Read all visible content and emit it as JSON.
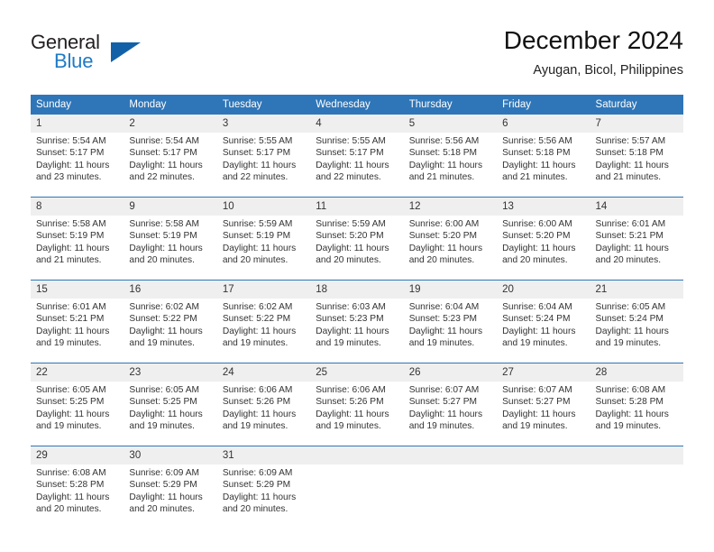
{
  "brand": {
    "name_part1": "General",
    "name_part2": "Blue",
    "triangle_icon": "triangle-icon",
    "color_dark": "#231f20",
    "color_blue": "#1f7ac6",
    "color_triangle": "#1261a8"
  },
  "header": {
    "title": "December 2024",
    "subtitle": "Ayugan, Bicol, Philippines"
  },
  "theme": {
    "header_blue": "#2f76b8",
    "daynum_gray": "#efefef",
    "text": "#333333"
  },
  "calendar": {
    "weekday_headers": [
      "Sunday",
      "Monday",
      "Tuesday",
      "Wednesday",
      "Thursday",
      "Friday",
      "Saturday"
    ],
    "weeks": [
      [
        {
          "day": "1",
          "sunrise": "Sunrise: 5:54 AM",
          "sunset": "Sunset: 5:17 PM",
          "daylight_line1": "Daylight: 11 hours",
          "daylight_line2": "and 23 minutes."
        },
        {
          "day": "2",
          "sunrise": "Sunrise: 5:54 AM",
          "sunset": "Sunset: 5:17 PM",
          "daylight_line1": "Daylight: 11 hours",
          "daylight_line2": "and 22 minutes."
        },
        {
          "day": "3",
          "sunrise": "Sunrise: 5:55 AM",
          "sunset": "Sunset: 5:17 PM",
          "daylight_line1": "Daylight: 11 hours",
          "daylight_line2": "and 22 minutes."
        },
        {
          "day": "4",
          "sunrise": "Sunrise: 5:55 AM",
          "sunset": "Sunset: 5:17 PM",
          "daylight_line1": "Daylight: 11 hours",
          "daylight_line2": "and 22 minutes."
        },
        {
          "day": "5",
          "sunrise": "Sunrise: 5:56 AM",
          "sunset": "Sunset: 5:18 PM",
          "daylight_line1": "Daylight: 11 hours",
          "daylight_line2": "and 21 minutes."
        },
        {
          "day": "6",
          "sunrise": "Sunrise: 5:56 AM",
          "sunset": "Sunset: 5:18 PM",
          "daylight_line1": "Daylight: 11 hours",
          "daylight_line2": "and 21 minutes."
        },
        {
          "day": "7",
          "sunrise": "Sunrise: 5:57 AM",
          "sunset": "Sunset: 5:18 PM",
          "daylight_line1": "Daylight: 11 hours",
          "daylight_line2": "and 21 minutes."
        }
      ],
      [
        {
          "day": "8",
          "sunrise": "Sunrise: 5:58 AM",
          "sunset": "Sunset: 5:19 PM",
          "daylight_line1": "Daylight: 11 hours",
          "daylight_line2": "and 21 minutes."
        },
        {
          "day": "9",
          "sunrise": "Sunrise: 5:58 AM",
          "sunset": "Sunset: 5:19 PM",
          "daylight_line1": "Daylight: 11 hours",
          "daylight_line2": "and 20 minutes."
        },
        {
          "day": "10",
          "sunrise": "Sunrise: 5:59 AM",
          "sunset": "Sunset: 5:19 PM",
          "daylight_line1": "Daylight: 11 hours",
          "daylight_line2": "and 20 minutes."
        },
        {
          "day": "11",
          "sunrise": "Sunrise: 5:59 AM",
          "sunset": "Sunset: 5:20 PM",
          "daylight_line1": "Daylight: 11 hours",
          "daylight_line2": "and 20 minutes."
        },
        {
          "day": "12",
          "sunrise": "Sunrise: 6:00 AM",
          "sunset": "Sunset: 5:20 PM",
          "daylight_line1": "Daylight: 11 hours",
          "daylight_line2": "and 20 minutes."
        },
        {
          "day": "13",
          "sunrise": "Sunrise: 6:00 AM",
          "sunset": "Sunset: 5:20 PM",
          "daylight_line1": "Daylight: 11 hours",
          "daylight_line2": "and 20 minutes."
        },
        {
          "day": "14",
          "sunrise": "Sunrise: 6:01 AM",
          "sunset": "Sunset: 5:21 PM",
          "daylight_line1": "Daylight: 11 hours",
          "daylight_line2": "and 20 minutes."
        }
      ],
      [
        {
          "day": "15",
          "sunrise": "Sunrise: 6:01 AM",
          "sunset": "Sunset: 5:21 PM",
          "daylight_line1": "Daylight: 11 hours",
          "daylight_line2": "and 19 minutes."
        },
        {
          "day": "16",
          "sunrise": "Sunrise: 6:02 AM",
          "sunset": "Sunset: 5:22 PM",
          "daylight_line1": "Daylight: 11 hours",
          "daylight_line2": "and 19 minutes."
        },
        {
          "day": "17",
          "sunrise": "Sunrise: 6:02 AM",
          "sunset": "Sunset: 5:22 PM",
          "daylight_line1": "Daylight: 11 hours",
          "daylight_line2": "and 19 minutes."
        },
        {
          "day": "18",
          "sunrise": "Sunrise: 6:03 AM",
          "sunset": "Sunset: 5:23 PM",
          "daylight_line1": "Daylight: 11 hours",
          "daylight_line2": "and 19 minutes."
        },
        {
          "day": "19",
          "sunrise": "Sunrise: 6:04 AM",
          "sunset": "Sunset: 5:23 PM",
          "daylight_line1": "Daylight: 11 hours",
          "daylight_line2": "and 19 minutes."
        },
        {
          "day": "20",
          "sunrise": "Sunrise: 6:04 AM",
          "sunset": "Sunset: 5:24 PM",
          "daylight_line1": "Daylight: 11 hours",
          "daylight_line2": "and 19 minutes."
        },
        {
          "day": "21",
          "sunrise": "Sunrise: 6:05 AM",
          "sunset": "Sunset: 5:24 PM",
          "daylight_line1": "Daylight: 11 hours",
          "daylight_line2": "and 19 minutes."
        }
      ],
      [
        {
          "day": "22",
          "sunrise": "Sunrise: 6:05 AM",
          "sunset": "Sunset: 5:25 PM",
          "daylight_line1": "Daylight: 11 hours",
          "daylight_line2": "and 19 minutes."
        },
        {
          "day": "23",
          "sunrise": "Sunrise: 6:05 AM",
          "sunset": "Sunset: 5:25 PM",
          "daylight_line1": "Daylight: 11 hours",
          "daylight_line2": "and 19 minutes."
        },
        {
          "day": "24",
          "sunrise": "Sunrise: 6:06 AM",
          "sunset": "Sunset: 5:26 PM",
          "daylight_line1": "Daylight: 11 hours",
          "daylight_line2": "and 19 minutes."
        },
        {
          "day": "25",
          "sunrise": "Sunrise: 6:06 AM",
          "sunset": "Sunset: 5:26 PM",
          "daylight_line1": "Daylight: 11 hours",
          "daylight_line2": "and 19 minutes."
        },
        {
          "day": "26",
          "sunrise": "Sunrise: 6:07 AM",
          "sunset": "Sunset: 5:27 PM",
          "daylight_line1": "Daylight: 11 hours",
          "daylight_line2": "and 19 minutes."
        },
        {
          "day": "27",
          "sunrise": "Sunrise: 6:07 AM",
          "sunset": "Sunset: 5:27 PM",
          "daylight_line1": "Daylight: 11 hours",
          "daylight_line2": "and 19 minutes."
        },
        {
          "day": "28",
          "sunrise": "Sunrise: 6:08 AM",
          "sunset": "Sunset: 5:28 PM",
          "daylight_line1": "Daylight: 11 hours",
          "daylight_line2": "and 19 minutes."
        }
      ],
      [
        {
          "day": "29",
          "sunrise": "Sunrise: 6:08 AM",
          "sunset": "Sunset: 5:28 PM",
          "daylight_line1": "Daylight: 11 hours",
          "daylight_line2": "and 20 minutes."
        },
        {
          "day": "30",
          "sunrise": "Sunrise: 6:09 AM",
          "sunset": "Sunset: 5:29 PM",
          "daylight_line1": "Daylight: 11 hours",
          "daylight_line2": "and 20 minutes."
        },
        {
          "day": "31",
          "sunrise": "Sunrise: 6:09 AM",
          "sunset": "Sunset: 5:29 PM",
          "daylight_line1": "Daylight: 11 hours",
          "daylight_line2": "and 20 minutes."
        },
        {
          "day": "",
          "sunrise": "",
          "sunset": "",
          "daylight_line1": "",
          "daylight_line2": ""
        },
        {
          "day": "",
          "sunrise": "",
          "sunset": "",
          "daylight_line1": "",
          "daylight_line2": ""
        },
        {
          "day": "",
          "sunrise": "",
          "sunset": "",
          "daylight_line1": "",
          "daylight_line2": ""
        },
        {
          "day": "",
          "sunrise": "",
          "sunset": "",
          "daylight_line1": "",
          "daylight_line2": ""
        }
      ]
    ]
  }
}
